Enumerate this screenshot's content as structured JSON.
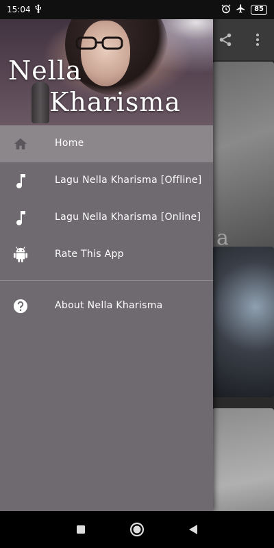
{
  "status_bar": {
    "time": "15:04",
    "usb_icon": "usb-icon",
    "alarm_icon": "alarm-icon",
    "airplane_icon": "airplane-mode-icon",
    "battery_level": "85"
  },
  "toolbar": {
    "share_icon": "share-icon",
    "overflow_icon": "more-vert-icon"
  },
  "background_content": {
    "partial_text": "a"
  },
  "drawer": {
    "header": {
      "title_line1": "Nella",
      "title_line2": "Kharisma"
    },
    "items": [
      {
        "label": "Home",
        "icon": "home-icon",
        "active": true
      },
      {
        "label": "Lagu Nella Kharisma [Offline]",
        "icon": "music-note-icon",
        "active": false
      },
      {
        "label": "Lagu Nella Kharisma [Online]",
        "icon": "music-note-icon",
        "active": false
      },
      {
        "label": "Rate This App",
        "icon": "android-icon",
        "active": false
      }
    ],
    "secondary_items": [
      {
        "label": "About Nella Kharisma",
        "icon": "help-circle-icon"
      }
    ]
  },
  "nav_bar": {
    "recents_icon": "recents-square-icon",
    "home_icon": "home-circle-icon",
    "back_icon": "back-triangle-icon"
  },
  "colors": {
    "drawer_bg": "#6f6a70",
    "active_item_bg": "#8b878b",
    "text": "#ffffff"
  }
}
